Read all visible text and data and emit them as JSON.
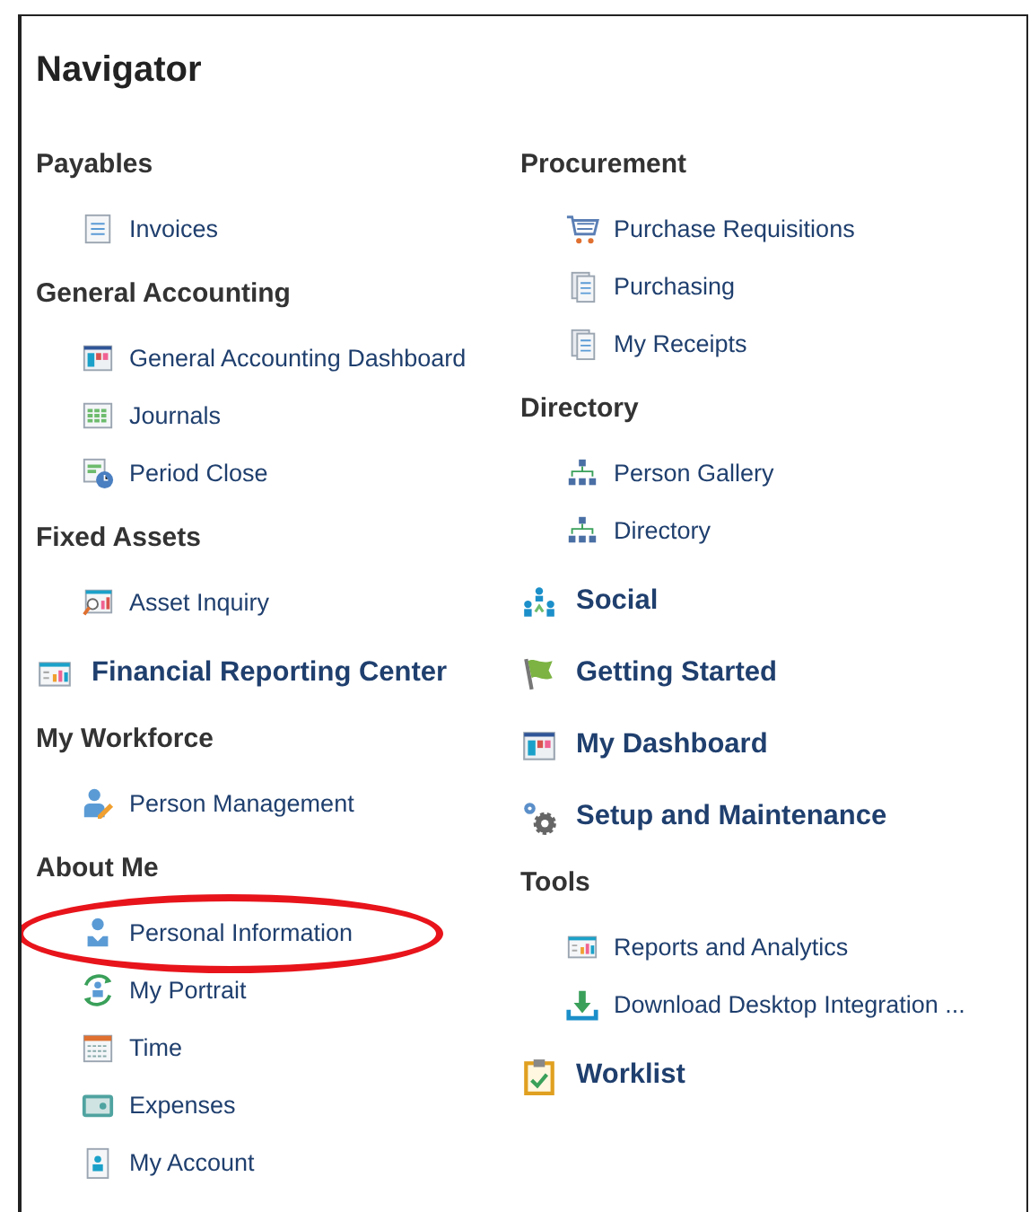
{
  "title": "Navigator",
  "columns": [
    {
      "entries": [
        {
          "kind": "group",
          "title": "Payables",
          "items": [
            {
              "label": "Invoices",
              "highlighted": false
            }
          ]
        },
        {
          "kind": "group",
          "title": "General Accounting",
          "items": [
            {
              "label": "General Accounting Dashboard",
              "highlighted": false
            },
            {
              "label": "Journals",
              "highlighted": false
            },
            {
              "label": "Period Close",
              "highlighted": false
            }
          ]
        },
        {
          "kind": "group",
          "title": "Fixed Assets",
          "items": [
            {
              "label": "Asset Inquiry",
              "highlighted": false
            }
          ]
        },
        {
          "kind": "link",
          "label": "Financial Reporting Center"
        },
        {
          "kind": "group",
          "title": "My Workforce",
          "items": [
            {
              "label": "Person Management",
              "highlighted": false
            }
          ]
        },
        {
          "kind": "group",
          "title": "About Me",
          "items": [
            {
              "label": "Personal Information",
              "highlighted": true
            },
            {
              "label": "My Portrait",
              "highlighted": false
            },
            {
              "label": "Time",
              "highlighted": false
            },
            {
              "label": "Expenses",
              "highlighted": false
            },
            {
              "label": "My Account",
              "highlighted": false
            }
          ]
        }
      ]
    },
    {
      "entries": [
        {
          "kind": "group",
          "title": "Procurement",
          "items": [
            {
              "label": "Purchase Requisitions",
              "highlighted": false
            },
            {
              "label": "Purchasing",
              "highlighted": false
            },
            {
              "label": "My Receipts",
              "highlighted": false
            }
          ]
        },
        {
          "kind": "group",
          "title": "Directory",
          "items": [
            {
              "label": "Person Gallery",
              "highlighted": false
            },
            {
              "label": "Directory",
              "highlighted": false
            }
          ]
        },
        {
          "kind": "link",
          "label": "Social"
        },
        {
          "kind": "link",
          "label": "Getting Started"
        },
        {
          "kind": "link",
          "label": "My Dashboard"
        },
        {
          "kind": "link",
          "label": "Setup and Maintenance"
        },
        {
          "kind": "group",
          "title": "Tools",
          "items": [
            {
              "label": "Reports and Analytics",
              "highlighted": false
            },
            {
              "label": "Download Desktop Integration ...",
              "highlighted": false
            }
          ]
        },
        {
          "kind": "link",
          "label": "Worklist"
        }
      ]
    }
  ]
}
